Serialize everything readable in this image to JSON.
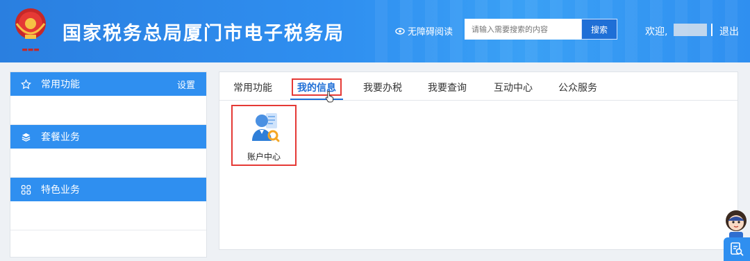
{
  "header": {
    "title": "国家税务总局厦门市电子税务局",
    "accessibility_label": "无障碍阅读",
    "search_placeholder": "请输入需要搜索的内容",
    "search_button": "搜索",
    "welcome": "欢迎,",
    "logout": "退出",
    "logo_icon": "tax-emblem-icon"
  },
  "sidebar": {
    "sections": [
      {
        "label": "常用功能",
        "icon": "star-icon",
        "extra": "设置"
      },
      {
        "label": "套餐业务",
        "icon": "layers-icon"
      },
      {
        "label": "特色业务",
        "icon": "grid-icon"
      }
    ]
  },
  "main": {
    "tabs": [
      {
        "label": "常用功能"
      },
      {
        "label": "我的信息",
        "active": true
      },
      {
        "label": "我要办税"
      },
      {
        "label": "我要查询"
      },
      {
        "label": "互动中心"
      },
      {
        "label": "公众服务"
      }
    ],
    "apps": [
      {
        "label": "账户中心",
        "icon": "account-center-icon"
      }
    ]
  },
  "colors": {
    "brand_blue": "#2f8ff0",
    "highlight_red": "#e53935",
    "active_tab": "#1f6fd6"
  }
}
